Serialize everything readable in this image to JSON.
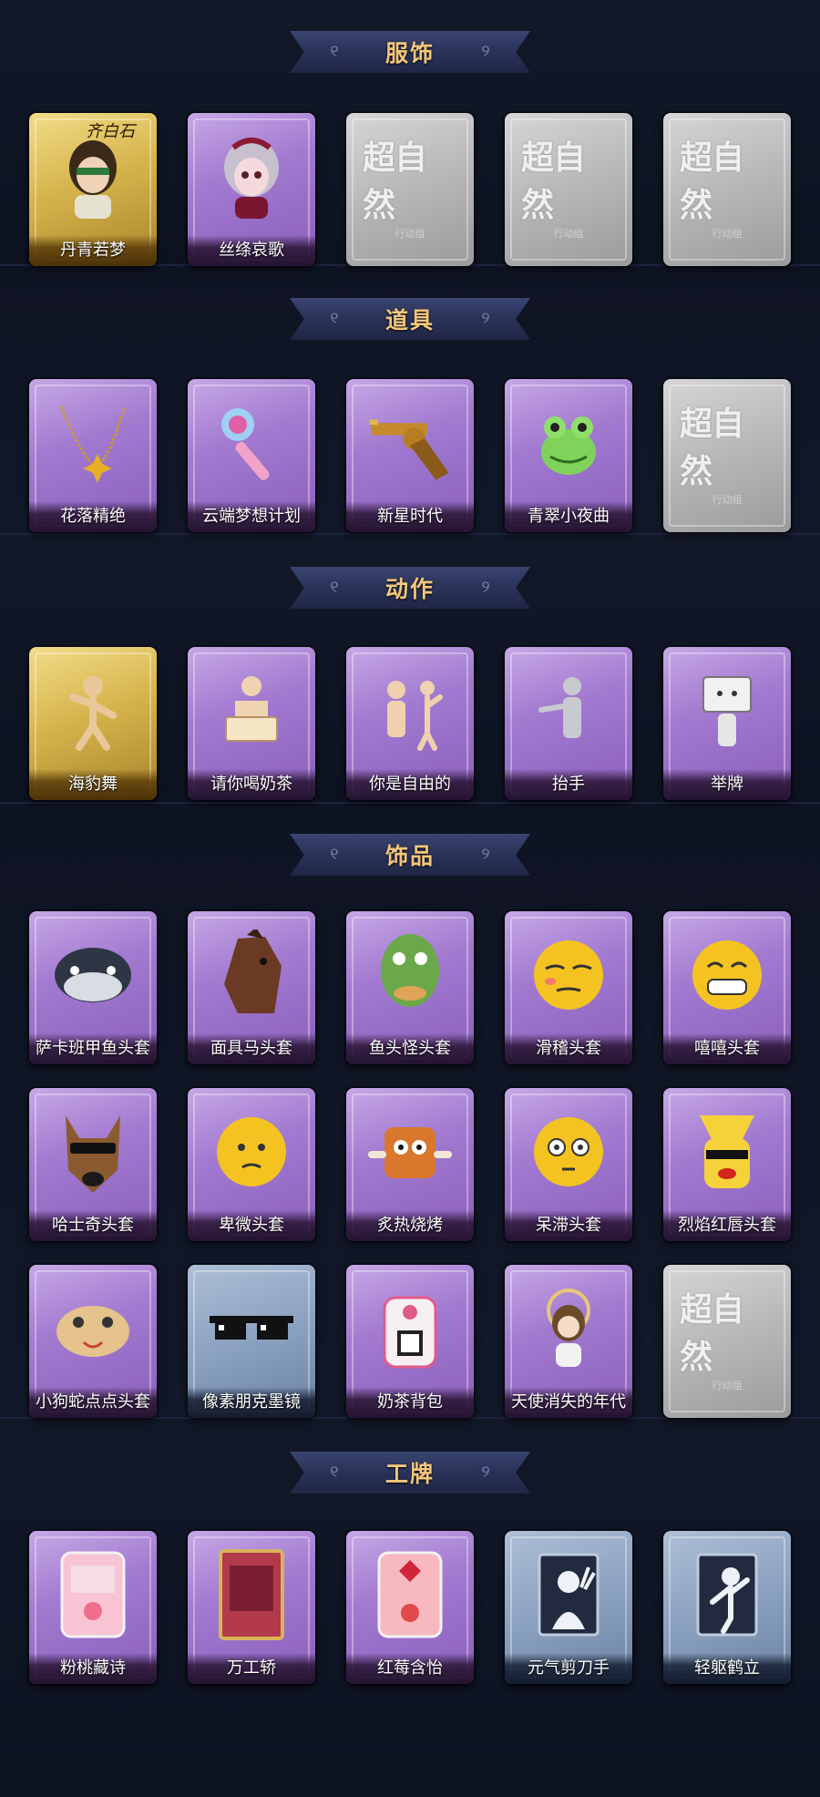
{
  "colors": {
    "background": "#101524",
    "banner_text": "#f2c67b",
    "card_purple": "#a27ad0",
    "card_gold": "#d6b44c",
    "card_grey": "#b7b7b7",
    "card_blue": "#8ba1c0"
  },
  "placeholder": {
    "title": "超自然",
    "subtitle": "行动组"
  },
  "sections": [
    {
      "title": "服饰",
      "items": [
        {
          "label": "丹青若梦",
          "style": "gold",
          "icon": "character-icon",
          "signature": "齐白石"
        },
        {
          "label": "丝绦哀歌",
          "style": "purple",
          "icon": "doll-character-icon"
        },
        {
          "label": "",
          "style": "grey",
          "icon": "placeholder-icon"
        },
        {
          "label": "",
          "style": "grey",
          "icon": "placeholder-icon"
        },
        {
          "label": "",
          "style": "grey",
          "icon": "placeholder-icon"
        }
      ]
    },
    {
      "title": "道具",
      "items": [
        {
          "label": "花落精绝",
          "style": "purple",
          "icon": "flower-necklace-icon"
        },
        {
          "label": "云端梦想计划",
          "style": "purple",
          "icon": "scepter-icon"
        },
        {
          "label": "新星时代",
          "style": "purple",
          "icon": "revolver-icon"
        },
        {
          "label": "青翠小夜曲",
          "style": "purple",
          "icon": "frog-icon"
        },
        {
          "label": "",
          "style": "grey",
          "icon": "placeholder-icon"
        }
      ]
    },
    {
      "title": "动作",
      "items": [
        {
          "label": "海豹舞",
          "style": "gold",
          "icon": "dance-pose-icon"
        },
        {
          "label": "请你喝奶茶",
          "style": "purple",
          "icon": "sign-pose-icon"
        },
        {
          "label": "你是自由的",
          "style": "purple",
          "icon": "two-figures-icon"
        },
        {
          "label": "抬手",
          "style": "purple",
          "icon": "raise-hand-icon"
        },
        {
          "label": "举牌",
          "style": "purple",
          "icon": "hold-sign-icon"
        }
      ]
    },
    {
      "title": "饰品",
      "items": [
        {
          "label": "萨卡班甲鱼头套",
          "style": "purple",
          "icon": "fish-head-icon"
        },
        {
          "label": "面具马头套",
          "style": "purple",
          "icon": "horse-head-icon"
        },
        {
          "label": "鱼头怪头套",
          "style": "purple",
          "icon": "fish-monster-icon"
        },
        {
          "label": "滑稽头套",
          "style": "purple",
          "icon": "funny-face-icon"
        },
        {
          "label": "嘻嘻头套",
          "style": "purple",
          "icon": "grin-face-icon"
        },
        {
          "label": "哈士奇头套",
          "style": "purple",
          "icon": "husky-icon"
        },
        {
          "label": "卑微头套",
          "style": "purple",
          "icon": "humble-face-icon"
        },
        {
          "label": "炙热烧烤",
          "style": "purple",
          "icon": "bbq-icon"
        },
        {
          "label": "呆滞头套",
          "style": "purple",
          "icon": "dazed-face-icon"
        },
        {
          "label": "烈焰红唇头套",
          "style": "purple",
          "icon": "pikachu-icon"
        },
        {
          "label": "小狗蛇点点头套",
          "style": "purple",
          "icon": "snake-head-icon"
        },
        {
          "label": "像素朋克墨镜",
          "style": "blue",
          "icon": "pixel-sunglasses-icon"
        },
        {
          "label": "奶茶背包",
          "style": "purple",
          "icon": "milk-tea-bag-icon"
        },
        {
          "label": "天使消失的年代",
          "style": "purple",
          "icon": "angel-doll-icon"
        },
        {
          "label": "",
          "style": "grey",
          "icon": "placeholder-icon"
        }
      ]
    },
    {
      "title": "工牌",
      "items": [
        {
          "label": "粉桃藏诗",
          "style": "purple",
          "icon": "peach-card-icon"
        },
        {
          "label": "万工轿",
          "style": "purple",
          "icon": "sedan-card-icon"
        },
        {
          "label": "红莓含怡",
          "style": "purple",
          "icon": "berry-card-icon"
        },
        {
          "label": "元气剪刀手",
          "style": "blue",
          "icon": "peace-silhouette-icon"
        },
        {
          "label": "轻躯鹤立",
          "style": "blue",
          "icon": "crane-pose-silhouette-icon"
        }
      ]
    }
  ]
}
